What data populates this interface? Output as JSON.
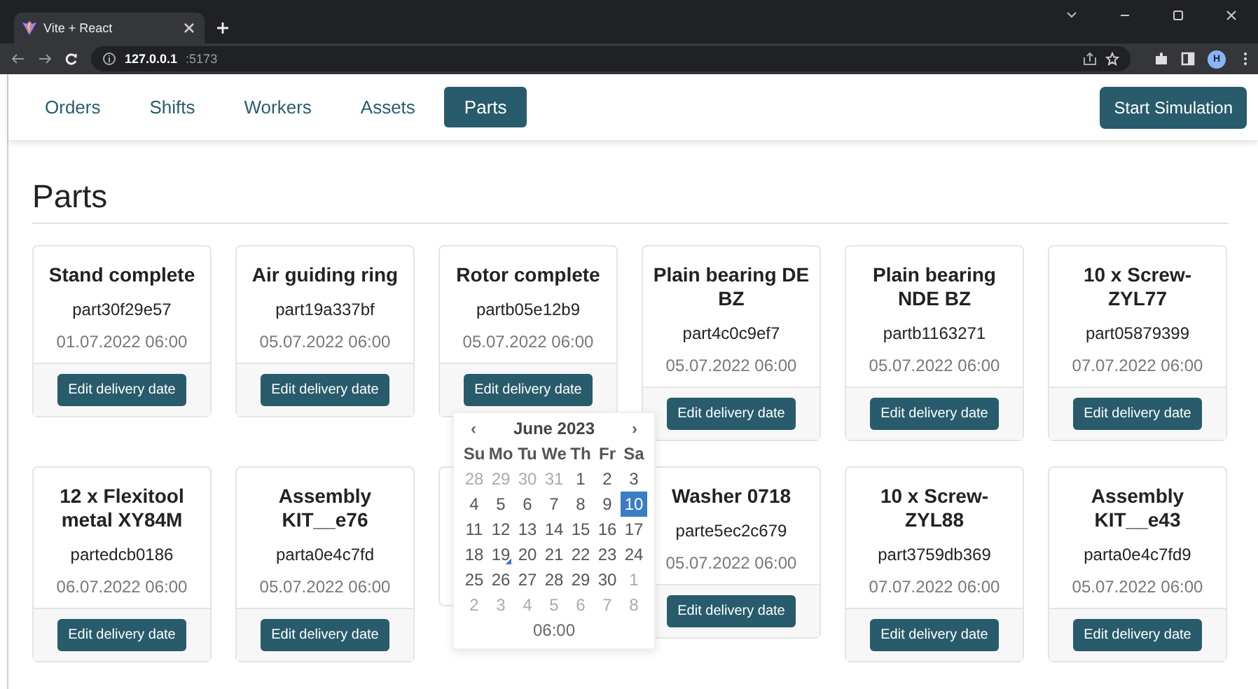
{
  "browser": {
    "tab_title": "Vite + React",
    "url_host": "127.0.0.1",
    "url_port": ":5173",
    "profile": "H"
  },
  "nav": {
    "tabs": [
      {
        "label": "Orders",
        "selected": false
      },
      {
        "label": "Shifts",
        "selected": false
      },
      {
        "label": "Workers",
        "selected": false
      },
      {
        "label": "Assets",
        "selected": false
      },
      {
        "label": "Parts",
        "selected": true
      }
    ],
    "action": "Start Simulation"
  },
  "heading": "Parts",
  "parts": [
    {
      "kind": "card",
      "name": "Stand complete",
      "id": "part30f29e57",
      "date": "01.07.2022 06:00",
      "button": "Edit delivery date"
    },
    {
      "kind": "card",
      "name": "Air guiding ring",
      "id": "part19a337bf",
      "date": "05.07.2022 06:00",
      "button": "Edit delivery date"
    },
    {
      "kind": "card",
      "name": "Rotor complete",
      "id": "partb05e12b9",
      "date": "05.07.2022 06:00",
      "button": "Edit delivery date",
      "picker_open": true
    },
    {
      "kind": "card",
      "name": "Plain bearing DE BZ",
      "id": "part4c0c9ef7",
      "date": "05.07.2022 06:00",
      "button": "Edit delivery date"
    },
    {
      "kind": "card",
      "name": "Plain bearing NDE BZ",
      "id": "partb1163271",
      "date": "05.07.2022 06:00",
      "button": "Edit delivery date"
    },
    {
      "kind": "card",
      "name": "10 x Screw-ZYL77",
      "id": "part05879399",
      "date": "07.07.2022 06:00",
      "button": "Edit delivery date"
    },
    {
      "kind": "card",
      "name": "12 x Flexitool metal XY84M",
      "id": "partedcb0186",
      "date": "06.07.2022 06:00",
      "button": "Edit delivery date"
    },
    {
      "kind": "card",
      "name": "Assembly KIT__e76",
      "id": "parta0e4c7fd",
      "date": "05.07.2022 06:00",
      "button": "Edit delivery date"
    },
    {
      "kind": "covered"
    },
    {
      "kind": "card",
      "name": "Washer 0718",
      "id": "parte5ec2c679",
      "date": "05.07.2022 06:00",
      "button": "Edit delivery date"
    },
    {
      "kind": "card",
      "name": "10 x Screw-ZYL88",
      "id": "part3759db369",
      "date": "07.07.2022 06:00",
      "button": "Edit delivery date"
    },
    {
      "kind": "card",
      "name": "Assembly KIT__e43",
      "id": "parta0e4c7fd9",
      "date": "05.07.2022 06:00",
      "button": "Edit delivery date"
    }
  ],
  "datepicker": {
    "prev": "‹",
    "month": "June 2023",
    "next": "›",
    "weekdays": [
      "Su",
      "Mo",
      "Tu",
      "We",
      "Th",
      "Fr",
      "Sa"
    ],
    "days": [
      {
        "d": "28",
        "muted": true,
        "selected": false,
        "today": false
      },
      {
        "d": "29",
        "muted": true,
        "selected": false,
        "today": false
      },
      {
        "d": "30",
        "muted": true,
        "selected": false,
        "today": false
      },
      {
        "d": "31",
        "muted": true,
        "selected": false,
        "today": false
      },
      {
        "d": "1",
        "muted": false,
        "selected": false,
        "today": false
      },
      {
        "d": "2",
        "muted": false,
        "selected": false,
        "today": false
      },
      {
        "d": "3",
        "muted": false,
        "selected": false,
        "today": false
      },
      {
        "d": "4",
        "muted": false,
        "selected": false,
        "today": false
      },
      {
        "d": "5",
        "muted": false,
        "selected": false,
        "today": false
      },
      {
        "d": "6",
        "muted": false,
        "selected": false,
        "today": false
      },
      {
        "d": "7",
        "muted": false,
        "selected": false,
        "today": false
      },
      {
        "d": "8",
        "muted": false,
        "selected": false,
        "today": false
      },
      {
        "d": "9",
        "muted": false,
        "selected": false,
        "today": false
      },
      {
        "d": "10",
        "muted": false,
        "selected": true,
        "today": false
      },
      {
        "d": "11",
        "muted": false,
        "selected": false,
        "today": false
      },
      {
        "d": "12",
        "muted": false,
        "selected": false,
        "today": false
      },
      {
        "d": "13",
        "muted": false,
        "selected": false,
        "today": false
      },
      {
        "d": "14",
        "muted": false,
        "selected": false,
        "today": false
      },
      {
        "d": "15",
        "muted": false,
        "selected": false,
        "today": false
      },
      {
        "d": "16",
        "muted": false,
        "selected": false,
        "today": false
      },
      {
        "d": "17",
        "muted": false,
        "selected": false,
        "today": false
      },
      {
        "d": "18",
        "muted": false,
        "selected": false,
        "today": false
      },
      {
        "d": "19",
        "muted": false,
        "selected": false,
        "today": true
      },
      {
        "d": "20",
        "muted": false,
        "selected": false,
        "today": false
      },
      {
        "d": "21",
        "muted": false,
        "selected": false,
        "today": false
      },
      {
        "d": "22",
        "muted": false,
        "selected": false,
        "today": false
      },
      {
        "d": "23",
        "muted": false,
        "selected": false,
        "today": false
      },
      {
        "d": "24",
        "muted": false,
        "selected": false,
        "today": false
      },
      {
        "d": "25",
        "muted": false,
        "selected": false,
        "today": false
      },
      {
        "d": "26",
        "muted": false,
        "selected": false,
        "today": false
      },
      {
        "d": "27",
        "muted": false,
        "selected": false,
        "today": false
      },
      {
        "d": "28",
        "muted": false,
        "selected": false,
        "today": false
      },
      {
        "d": "29",
        "muted": false,
        "selected": false,
        "today": false
      },
      {
        "d": "30",
        "muted": false,
        "selected": false,
        "today": false
      },
      {
        "d": "1",
        "muted": true,
        "selected": false,
        "today": false
      },
      {
        "d": "2",
        "muted": true,
        "selected": false,
        "today": false
      },
      {
        "d": "3",
        "muted": true,
        "selected": false,
        "today": false
      },
      {
        "d": "4",
        "muted": true,
        "selected": false,
        "today": false
      },
      {
        "d": "5",
        "muted": true,
        "selected": false,
        "today": false
      },
      {
        "d": "6",
        "muted": true,
        "selected": false,
        "today": false
      },
      {
        "d": "7",
        "muted": true,
        "selected": false,
        "today": false
      },
      {
        "d": "8",
        "muted": true,
        "selected": false,
        "today": false
      }
    ],
    "time": "06:00"
  }
}
